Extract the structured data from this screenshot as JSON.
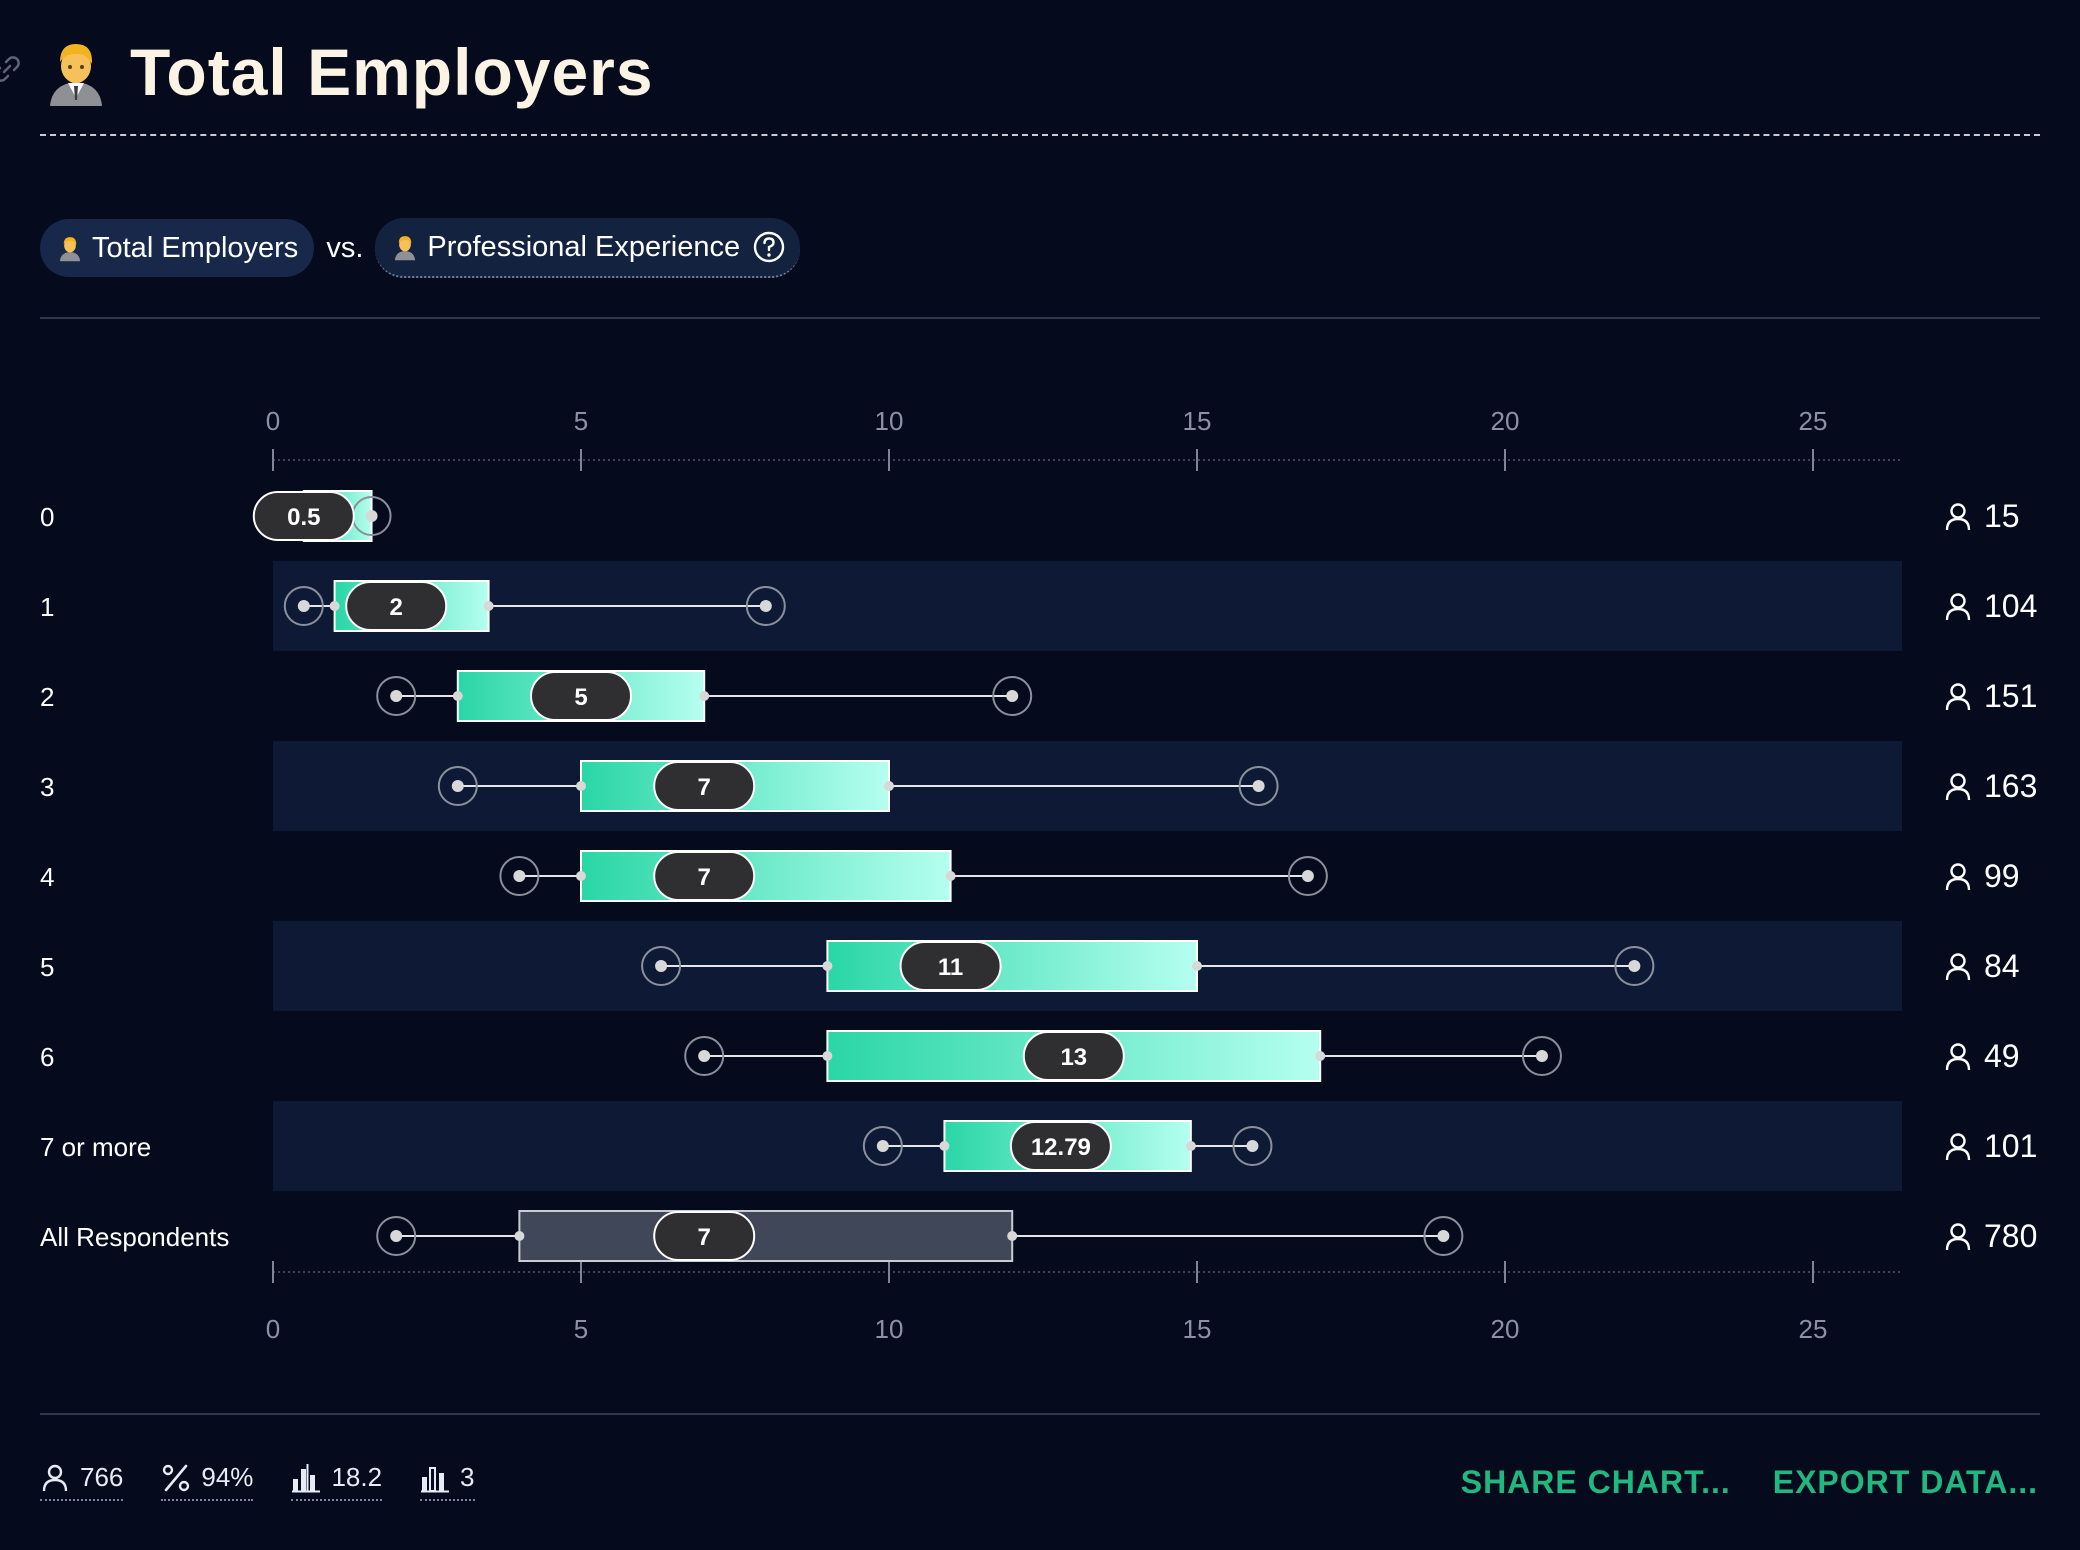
{
  "header": {
    "title": "Total Employers"
  },
  "comparison": {
    "primary_label": "Total Employers",
    "vs_label": "vs.",
    "secondary_label": "Professional Experience"
  },
  "chart_data": {
    "type": "boxplot",
    "x_ticks": [
      0,
      5,
      10,
      15,
      20,
      25
    ],
    "xlim": [
      0,
      26.5
    ],
    "grid": false,
    "categories": [
      {
        "label": "0",
        "whisker_low": 0.5,
        "q1": 0.5,
        "median": 0.5,
        "q3": 1.6,
        "whisker_high": 1.6,
        "count": "15",
        "highlight": true
      },
      {
        "label": "1",
        "whisker_low": 0.5,
        "q1": 1.0,
        "median": 2,
        "q3": 3.5,
        "whisker_high": 8,
        "count": "104",
        "highlight": true
      },
      {
        "label": "2",
        "whisker_low": 2,
        "q1": 3,
        "median": 5,
        "q3": 7,
        "whisker_high": 12,
        "count": "151",
        "highlight": true
      },
      {
        "label": "3",
        "whisker_low": 3,
        "q1": 5,
        "median": 7,
        "q3": 10,
        "whisker_high": 16,
        "count": "163",
        "highlight": true
      },
      {
        "label": "4",
        "whisker_low": 4,
        "q1": 5,
        "median": 7,
        "q3": 11,
        "whisker_high": 16.8,
        "count": "99",
        "highlight": true
      },
      {
        "label": "5",
        "whisker_low": 6.3,
        "q1": 9,
        "median": 11,
        "q3": 15,
        "whisker_high": 22.1,
        "count": "84",
        "highlight": true
      },
      {
        "label": "6",
        "whisker_low": 7,
        "q1": 9,
        "median": 13,
        "q3": 17,
        "whisker_high": 20.6,
        "count": "49",
        "highlight": true
      },
      {
        "label": "7 or more",
        "whisker_low": 9.9,
        "q1": 10.9,
        "median": 12.79,
        "q3": 14.9,
        "whisker_high": 15.9,
        "count": "101",
        "highlight": true
      },
      {
        "label": "All Respondents",
        "whisker_low": 2,
        "q1": 4,
        "median": 7,
        "q3": 12,
        "whisker_high": 19,
        "count": "780",
        "highlight": false
      }
    ],
    "colors": {
      "box_start": "#2ad6a6",
      "box_end": "#b5fff0",
      "overall_box": "#3f4758",
      "median_pill": "#2f2f31",
      "alt_row_band": "#0e1a35"
    }
  },
  "footer": {
    "stats": [
      {
        "icon": "person-icon",
        "value": "766"
      },
      {
        "icon": "percent-icon",
        "value": "94%"
      },
      {
        "icon": "mean-bars-icon",
        "value": "18.2"
      },
      {
        "icon": "bars-icon",
        "value": "3"
      }
    ],
    "actions": {
      "share": "SHARE CHART...",
      "export": "EXPORT DATA..."
    }
  }
}
